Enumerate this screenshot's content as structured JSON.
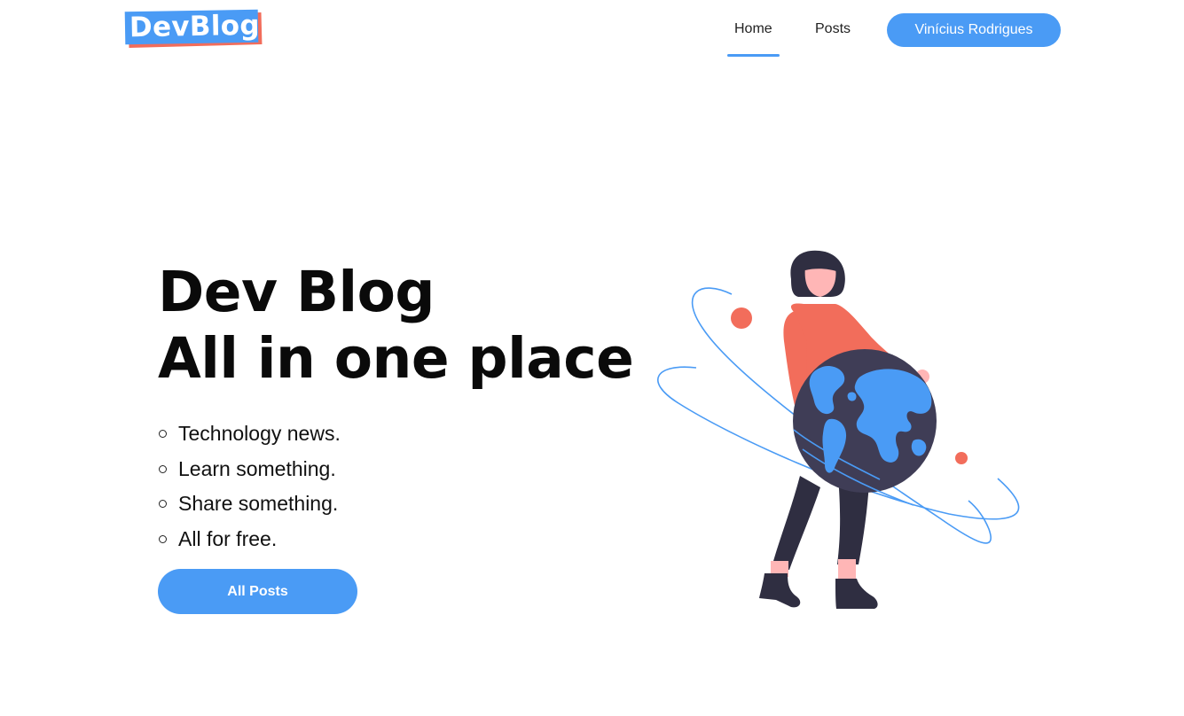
{
  "header": {
    "logo_text": "DevBlog",
    "nav": [
      {
        "label": "Home",
        "active": true
      },
      {
        "label": "Posts",
        "active": false
      }
    ],
    "user_button": "Vinícius Rodrigues"
  },
  "hero": {
    "title_line1": "Dev Blog",
    "title_line2": "All in one place",
    "features": [
      "Technology news.",
      "Learn something.",
      "Share something.",
      "All for free."
    ],
    "cta_label": "All Posts"
  },
  "colors": {
    "accent": "#4a9bf5",
    "logo_shadow": "#f26d5b",
    "coral": "#f26d5b",
    "dark": "#2f2e41",
    "skin": "#ffb6b6"
  },
  "icons": {
    "bullet": "hollow-circle",
    "illustration": "woman-holding-globe-illustration"
  }
}
